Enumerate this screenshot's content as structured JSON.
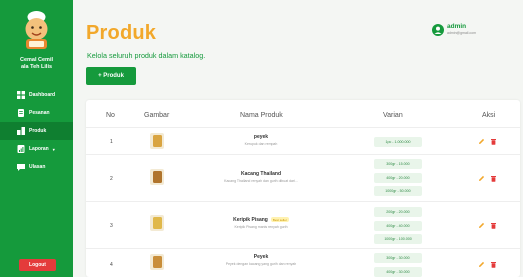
{
  "sidebar": {
    "brand": "Cemal Cemil\nala Teh Lilis",
    "items": [
      {
        "label": "Dashboard",
        "icon": "dashboard-icon"
      },
      {
        "label": "Pesanan",
        "icon": "orders-icon"
      },
      {
        "label": "Produk",
        "icon": "products-icon",
        "active": true
      },
      {
        "label": "Laporan",
        "icon": "report-icon",
        "has_caret": true
      },
      {
        "label": "Ulasan",
        "icon": "review-icon"
      }
    ],
    "logout": "Logout"
  },
  "header": {
    "title": "Produk",
    "subtitle": "Kelola seluruh produk dalam katalog.",
    "add_button": "+ Produk",
    "user": {
      "name": "admin",
      "email": "admin@gmail.com"
    }
  },
  "table": {
    "headers": {
      "no": "No",
      "image": "Gambar",
      "name": "Nama Produk",
      "variant": "Varian",
      "action": "Aksi"
    },
    "rows": [
      {
        "no": "1",
        "name": "peyek",
        "badge": "",
        "desc": "Kerupuk dan rempah",
        "variants": [
          "1pc - 1.000.000"
        ],
        "img_color": "#d9a441"
      },
      {
        "no": "2",
        "name": "Kacang Thailand",
        "badge": "",
        "desc": "Kacang Thailand renyah dan gurih dibuat dari...",
        "variants": [
          "300gr - 15.000",
          "400gr - 20.000",
          "1000gr - 50.000"
        ],
        "img_color": "#b0742c"
      },
      {
        "no": "3",
        "name": "Keripik Pisang",
        "badge": "Best seller",
        "desc": "Keripik Pisang manis renyah gurih",
        "variants": [
          "200gr - 20.000",
          "400gr - 40.000",
          "1000gr - 100.000"
        ],
        "img_color": "#e0b84a"
      },
      {
        "no": "4",
        "name": "Peyek",
        "badge": "",
        "desc": "Peyek dengan kacang yang gurih dan renyah",
        "variants": [
          "300gr - 30.000",
          "400gr - 30.000"
        ],
        "img_color": "#c98e3a"
      }
    ]
  },
  "colors": {
    "primary": "#159a3c",
    "accent": "#f2a82b",
    "danger": "#e43b3b",
    "edit": "#f2a82b"
  }
}
